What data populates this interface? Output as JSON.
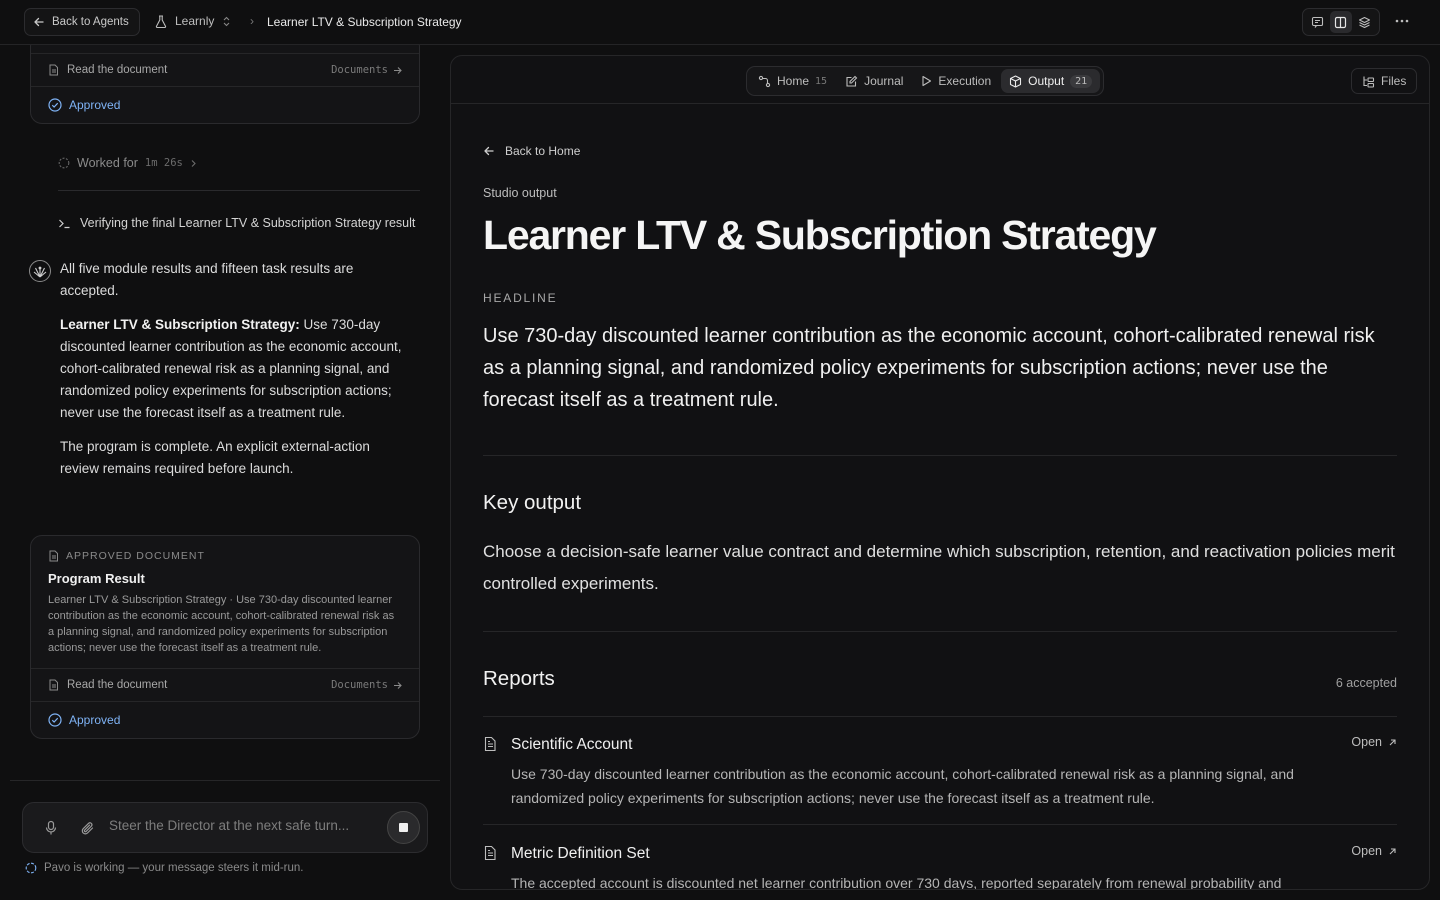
{
  "topbar": {
    "back_label": "Back to Agents",
    "app_name": "Learnly",
    "breadcrumb_title": "Learner LTV & Subscription Strategy"
  },
  "left": {
    "prev_card": {
      "read_label": "Read the document",
      "docs_label": "Documents",
      "status": "Approved"
    },
    "worked": {
      "label": "Worked for",
      "duration": "1m 26s"
    },
    "verify_text": "Verifying the final Learner LTV & Subscription Strategy result",
    "message": {
      "p1": "All five module results and fifteen task results are accepted.",
      "p2_bold": "Learner LTV & Subscription Strategy:",
      "p2": " Use 730-day discounted learner contribution as the economic account, cohort-calibrated renewal risk as a planning signal, and randomized policy experiments for subscription actions; never use the forecast itself as a treatment rule.",
      "p3": "The program is complete. An explicit external-action review remains required before launch."
    },
    "doc_card": {
      "kind": "APPROVED DOCUMENT",
      "title": "Program Result",
      "desc": "Learner LTV & Subscription Strategy · Use 730-day discounted learner contribution as the economic account, cohort-calibrated renewal risk as a planning signal, and randomized policy experiments for subscription actions; never use the forecast itself as a treatment rule.",
      "read_label": "Read the document",
      "docs_label": "Documents",
      "status": "Approved"
    },
    "composer": {
      "placeholder": "Steer the Director at the next safe turn..."
    },
    "status_line": "Pavo is working — your message steers it mid-run."
  },
  "tabs": [
    {
      "label": "Home",
      "count": "15"
    },
    {
      "label": "Journal",
      "count": ""
    },
    {
      "label": "Execution",
      "count": ""
    },
    {
      "label": "Output",
      "count": "21"
    }
  ],
  "files_label": "Files",
  "output": {
    "back_label": "Back to Home",
    "studio_label": "Studio output",
    "title": "Learner LTV & Subscription Strategy",
    "headline_label": "HEADLINE",
    "headline": "Use 730-day discounted learner contribution as the economic account, cohort-calibrated renewal risk as a planning signal, and randomized policy experiments for subscription actions; never use the forecast itself as a treatment rule.",
    "key_title": "Key output",
    "key_text": "Choose a decision-safe learner value contract and determine which subscription, retention, and reactivation policies merit controlled experiments.",
    "reports_title": "Reports",
    "reports_count": "6 accepted",
    "reports": [
      {
        "name": "Scientific Account",
        "open": "Open",
        "desc": "Use 730-day discounted learner contribution as the economic account, cohort-calibrated renewal risk as a planning signal, and randomized policy experiments for subscription actions; never use the forecast itself as a treatment rule."
      },
      {
        "name": "Metric Definition Set",
        "open": "Open",
        "desc": "The accepted account is discounted net learner contribution over 730 days, reported separately from renewal probability and"
      }
    ]
  },
  "colors": {
    "accent_blue": "#7fb3f5",
    "background": "#0f0f10"
  }
}
